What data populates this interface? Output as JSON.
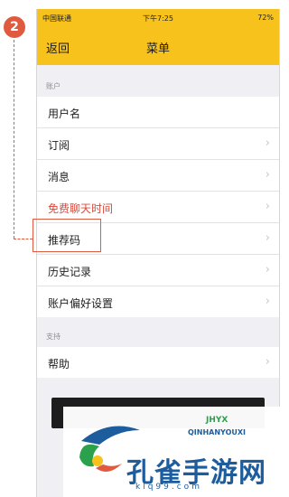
{
  "status": {
    "carrier": "中国联通",
    "time": "下午7:25",
    "battery": "72%"
  },
  "nav": {
    "back": "返回",
    "title": "菜单"
  },
  "sections": [
    {
      "header": "账户",
      "rows": [
        "用户名",
        "订阅",
        "消息",
        "免费聊天时间",
        "推荐码",
        "历史记录",
        "账户偏好设置"
      ]
    },
    {
      "header": "支持",
      "rows": [
        "帮助"
      ]
    }
  ],
  "annotation": {
    "step": "2"
  },
  "watermark": {
    "brand": "孔雀手游网",
    "pinyin": "QINHANYOUXI",
    "url": "klq99.com",
    "badge": "JHYX"
  },
  "colors": {
    "nav": "#f7c21c",
    "accent": "#e05a3f",
    "red_text": "#d94b3c"
  }
}
